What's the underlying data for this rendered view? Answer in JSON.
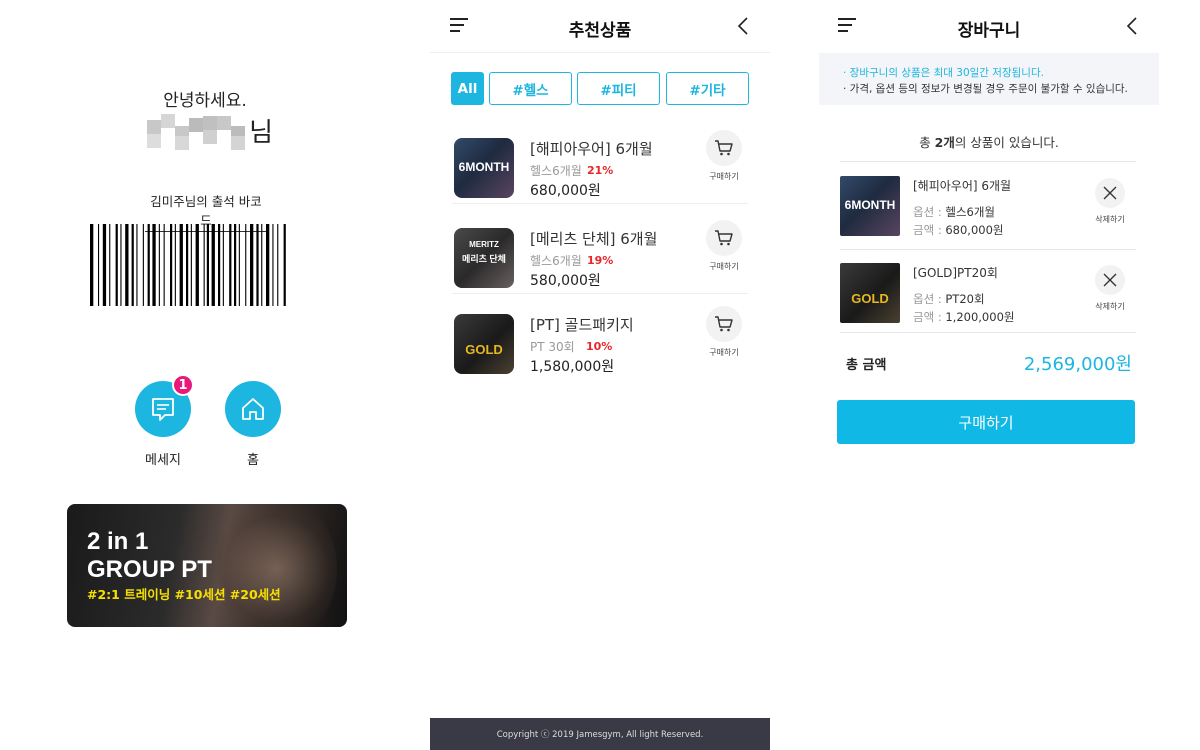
{
  "panel1": {
    "greeting": "안녕하세요.",
    "name_suffix": "님",
    "barcode_label": "김미주님의 출석 바코드",
    "quick": [
      {
        "label": "메세지",
        "badge": "1",
        "icon": "message-icon"
      },
      {
        "label": "홈",
        "icon": "home-icon"
      }
    ],
    "banner": {
      "line1": "2 in 1",
      "line2": "GROUP PT",
      "tags": "#2:1 트레이닝 #10세션 #20세션"
    }
  },
  "panel2": {
    "title": "추천상품",
    "chips": [
      {
        "label": "All",
        "active": true
      },
      {
        "label": "#헬스"
      },
      {
        "label": "#피티"
      },
      {
        "label": "#기타"
      }
    ],
    "products": [
      {
        "name": "[해피아우어] 6개월",
        "sub": "헬스6개월",
        "discount": "21%",
        "price": "680,000원",
        "cart_label": "구매하기",
        "thumb_text": "6MONTH"
      },
      {
        "name": "[메리츠 단체] 6개월",
        "sub": "헬스6개월",
        "discount": "19%",
        "price": "580,000원",
        "cart_label": "구매하기",
        "thumb_text": "메리츠 단체",
        "thumb_brand": "MERITZ"
      },
      {
        "name": "[PT] 골드패키지",
        "sub": "PT 30회",
        "discount": "10%",
        "price": "1,580,000원",
        "cart_label": "구매하기",
        "thumb_text": "GOLD"
      }
    ],
    "footer": "Copyright ⓒ 2019 Jamesgym, All light Reserved."
  },
  "panel3": {
    "title": "장바구니",
    "notice1": "· 장바구니의 상품은 최대 30일간 저장됩니다.",
    "notice2": "· 가격, 옵션 등의 정보가 변경될 경우 주문이 불가할 수 있습니다.",
    "count_prefix": "총 ",
    "count_value": "2개",
    "count_suffix": "의 상품이 있습니다.",
    "items": [
      {
        "name": "[해피아우어] 6개월",
        "opt_key": "옵션 :",
        "opt_val": "헬스6개월",
        "amt_key": "금액 :",
        "amt_val": "680,000원",
        "del_label": "삭제하기",
        "thumb_text": "6MONTH"
      },
      {
        "name": "[GOLD]PT20회",
        "opt_key": "옵션 :",
        "opt_val": "PT20회",
        "amt_key": "금액 :",
        "amt_val": "1,200,000원",
        "del_label": "삭제하기",
        "thumb_text": "GOLD"
      }
    ],
    "total_label": "총 금액",
    "total_value": "2,569,000원",
    "buy_label": "구매하기"
  },
  "colors": {
    "accent": "#1cb6e0",
    "badge": "#e8197a",
    "discount": "#e8262a"
  }
}
